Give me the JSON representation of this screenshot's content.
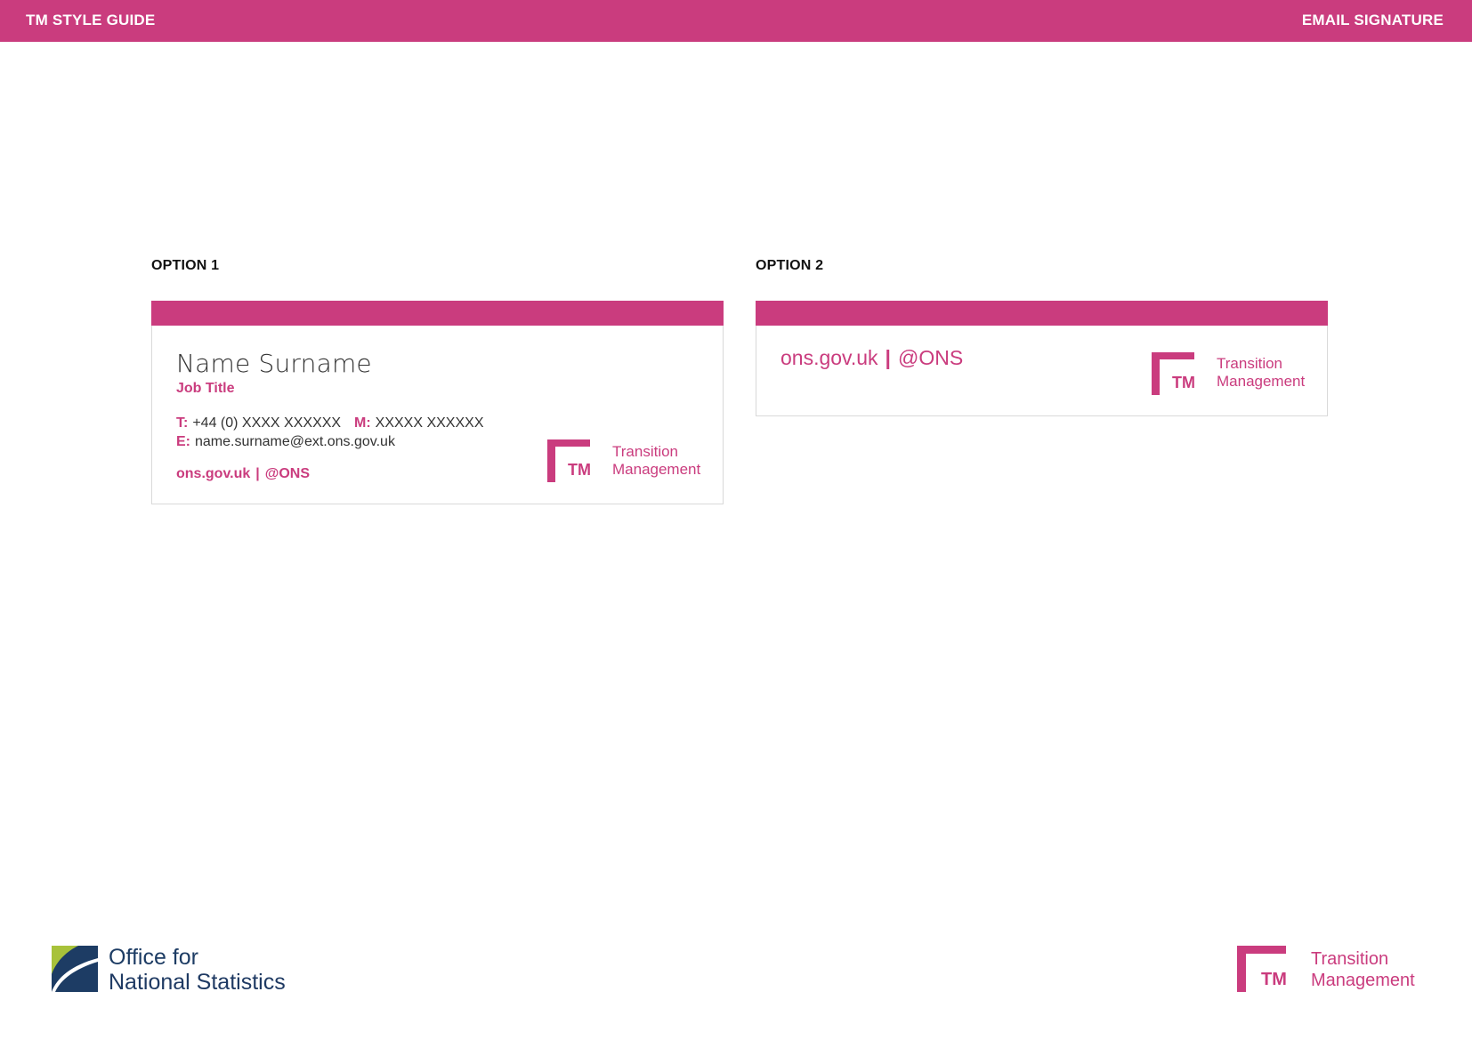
{
  "header": {
    "left_title": "TM STYLE GUIDE",
    "right_title": "EMAIL SIGNATURE"
  },
  "option1": {
    "label": "OPTION 1",
    "name": "Name Surname",
    "job_title": "Job Title",
    "phone_label": "T:",
    "phone": "+44 (0) XXXX XXXXXX",
    "mobile_label": "M:",
    "mobile": "XXXXX XXXXXX",
    "email_label": "E:",
    "email": "name.surname@ext.ons.gov.uk",
    "website": "ons.gov.uk",
    "separator": "|",
    "twitter": "@ONS",
    "logo": {
      "mark": "TM",
      "line1": "Transition",
      "line2": "Management"
    }
  },
  "option2": {
    "label": "OPTION 2",
    "website": "ons.gov.uk",
    "separator": "|",
    "twitter": "@ONS",
    "logo": {
      "mark": "TM",
      "line1": "Transition",
      "line2": "Management"
    }
  },
  "footer": {
    "ons_logo": {
      "line1": "Office for",
      "line2": "National Statistics"
    },
    "tm_logo": {
      "mark": "TM",
      "line1": "Transition",
      "line2": "Management"
    }
  },
  "colors": {
    "brand_pink": "#ca3c7e",
    "ons_navy": "#1d3c64",
    "ons_green": "#a8c23a"
  }
}
